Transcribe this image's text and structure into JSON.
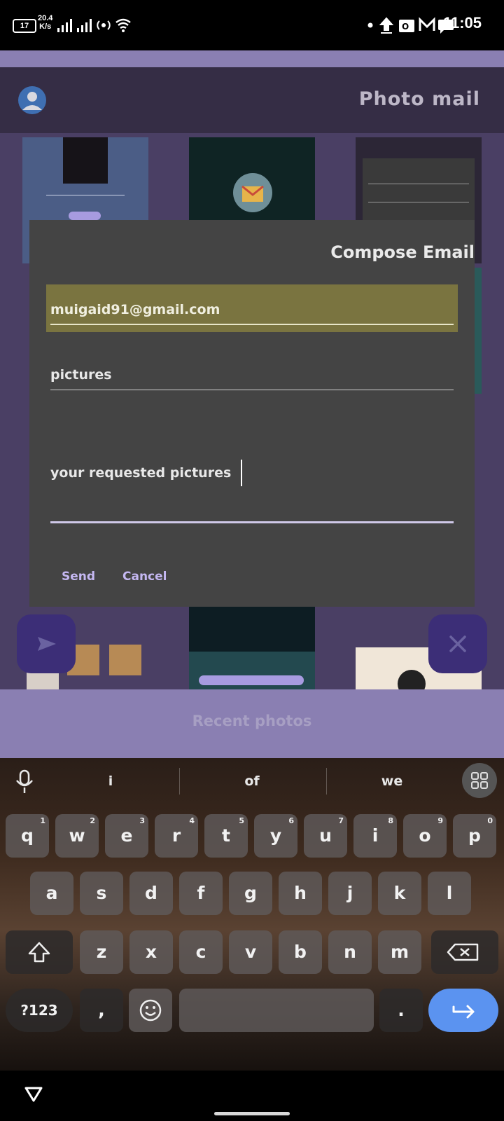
{
  "status_bar": {
    "battery_level": "17",
    "net_speed_value": "20.4",
    "net_speed_unit": "K/s",
    "time": "11:05",
    "icons": [
      "signal-icon",
      "signal-icon",
      "hotspot-icon",
      "wifi-icon",
      "dot-icon",
      "upload-icon",
      "outlook-icon",
      "gmail-icon",
      "chat-icon"
    ]
  },
  "app": {
    "title": "Photo mail",
    "recent_label": "Recent photos"
  },
  "dialog": {
    "title": "Compose Email",
    "to_value": "muigaid91@gmail.com",
    "subject_value": "pictures",
    "body_value": "your requested pictures",
    "send_label": "Send",
    "cancel_label": "Cancel"
  },
  "keyboard": {
    "suggestions": [
      "i",
      "of",
      "we"
    ],
    "row1": [
      {
        "key": "q",
        "hint": "1"
      },
      {
        "key": "w",
        "hint": "2"
      },
      {
        "key": "e",
        "hint": "3"
      },
      {
        "key": "r",
        "hint": "4"
      },
      {
        "key": "t",
        "hint": "5"
      },
      {
        "key": "y",
        "hint": "6"
      },
      {
        "key": "u",
        "hint": "7"
      },
      {
        "key": "i",
        "hint": "8"
      },
      {
        "key": "o",
        "hint": "9"
      },
      {
        "key": "p",
        "hint": "0"
      }
    ],
    "row2": [
      "a",
      "s",
      "d",
      "f",
      "g",
      "h",
      "j",
      "k",
      "l"
    ],
    "row3": [
      "z",
      "x",
      "c",
      "v",
      "b",
      "n",
      "m"
    ],
    "symbols_label": "?123",
    "comma": ",",
    "period": "."
  },
  "colors": {
    "dialog_bg": "#444444",
    "to_field_highlight": "#7a7440",
    "accent_button_text": "#c5b8f2",
    "fab_bg": "#3c2e77",
    "enter_key": "#5b93f0"
  }
}
